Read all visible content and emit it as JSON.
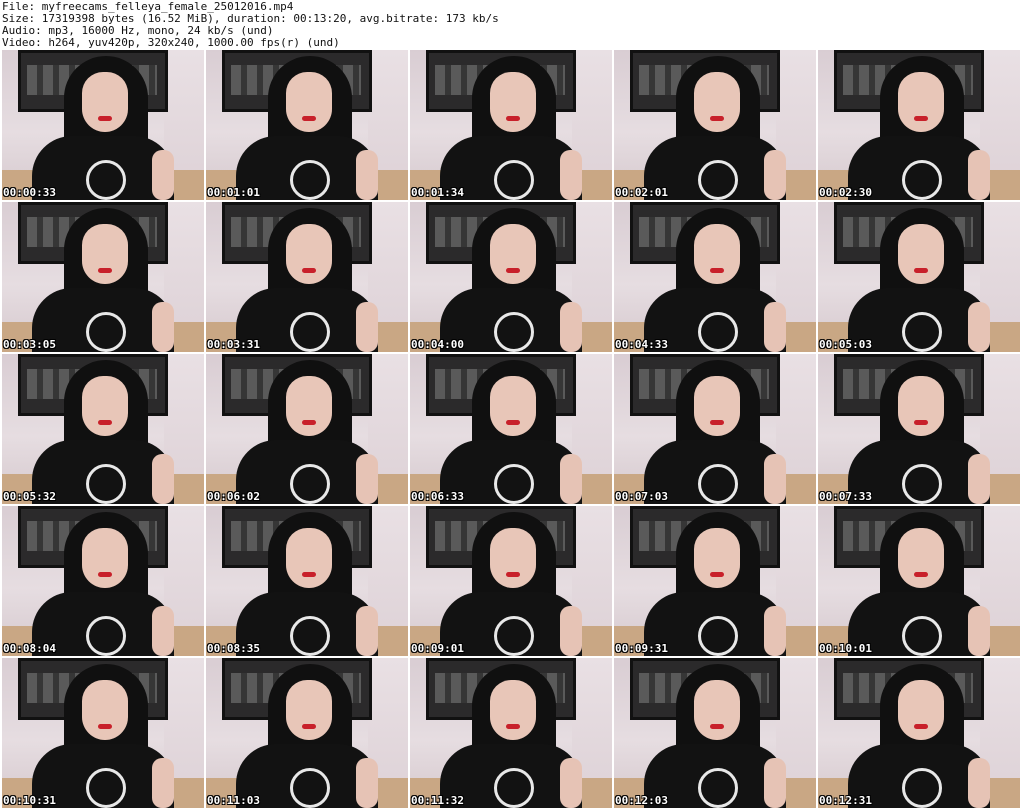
{
  "header": {
    "file_line": "File: myfreecams_felleya_female_25012016.mp4",
    "size_line": "Size: 17319398 bytes (16.52 MiB), duration: 00:13:20, avg.bitrate: 173 kb/s",
    "audio_line": "Audio: mp3, 16000 Hz, mono, 24 kb/s (und)",
    "video_line": "Video: h264, yuv420p, 320x240, 1000.00 fps(r) (und)"
  },
  "thumbnails": [
    {
      "timestamp": "00:00:33"
    },
    {
      "timestamp": "00:01:01"
    },
    {
      "timestamp": "00:01:34"
    },
    {
      "timestamp": "00:02:01"
    },
    {
      "timestamp": "00:02:30"
    },
    {
      "timestamp": "00:03:05"
    },
    {
      "timestamp": "00:03:31"
    },
    {
      "timestamp": "00:04:00"
    },
    {
      "timestamp": "00:04:33"
    },
    {
      "timestamp": "00:05:03"
    },
    {
      "timestamp": "00:05:32"
    },
    {
      "timestamp": "00:06:02"
    },
    {
      "timestamp": "00:06:33"
    },
    {
      "timestamp": "00:07:03"
    },
    {
      "timestamp": "00:07:33"
    },
    {
      "timestamp": "00:08:04"
    },
    {
      "timestamp": "00:08:35"
    },
    {
      "timestamp": "00:09:01"
    },
    {
      "timestamp": "00:09:31"
    },
    {
      "timestamp": "00:10:01"
    },
    {
      "timestamp": "00:10:31"
    },
    {
      "timestamp": "00:11:03"
    },
    {
      "timestamp": "00:11:32"
    },
    {
      "timestamp": "00:12:03"
    },
    {
      "timestamp": "00:12:31"
    }
  ],
  "colors": {
    "background": "#ffffff",
    "timestamp_text": "#ffffff",
    "timestamp_outline": "#000000",
    "header_text": "#111111"
  }
}
